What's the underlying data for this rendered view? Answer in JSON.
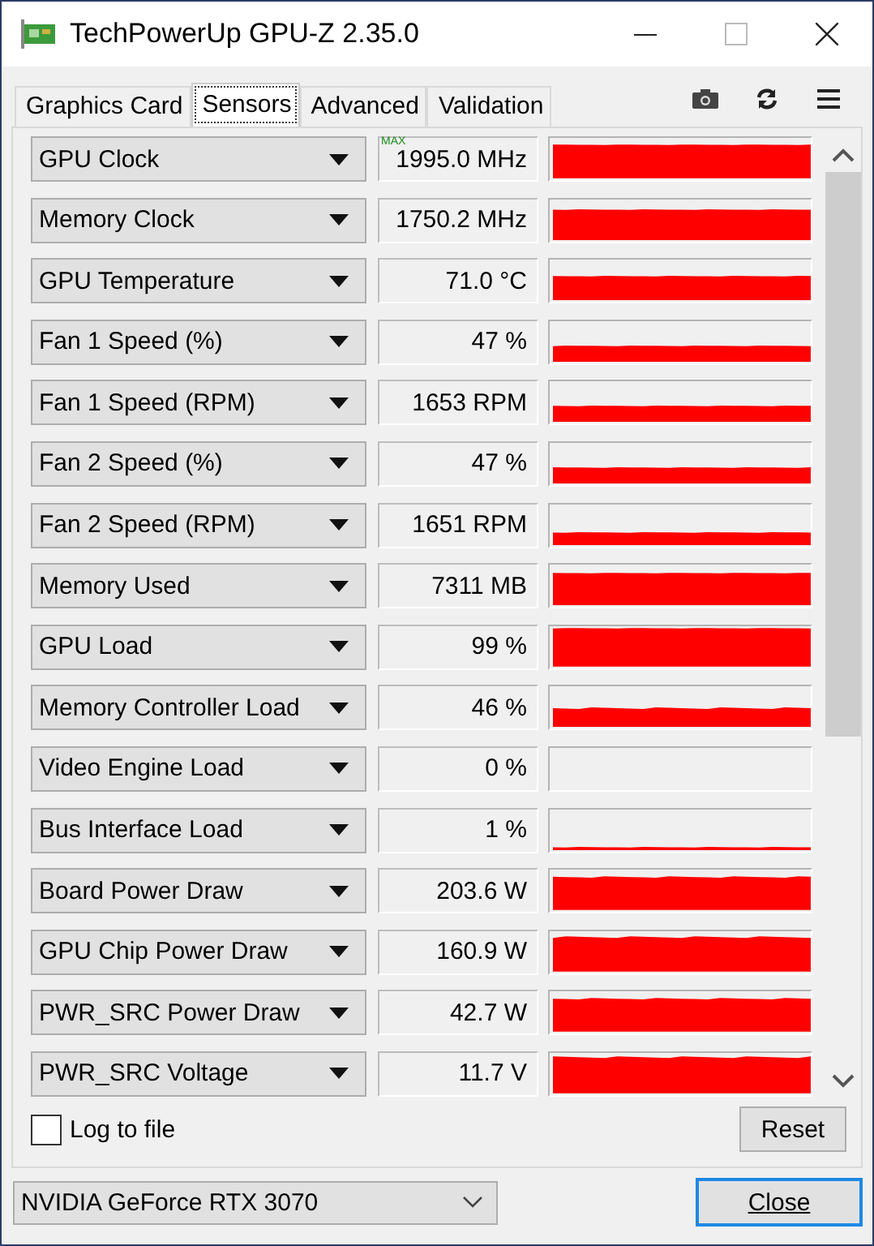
{
  "window": {
    "title": "TechPowerUp GPU-Z 2.35.0"
  },
  "tabs": [
    {
      "label": "Graphics Card",
      "selected": false
    },
    {
      "label": "Sensors",
      "selected": true
    },
    {
      "label": "Advanced",
      "selected": false
    },
    {
      "label": "Validation",
      "selected": false
    }
  ],
  "sensors": [
    {
      "name": "GPU Clock",
      "value": "1995.0 MHz",
      "badge": "MAX"
    },
    {
      "name": "Memory Clock",
      "value": "1750.2 MHz"
    },
    {
      "name": "GPU Temperature",
      "value": "71.0 °C"
    },
    {
      "name": "Fan 1 Speed (%)",
      "value": "47 %"
    },
    {
      "name": "Fan 1 Speed (RPM)",
      "value": "1653 RPM"
    },
    {
      "name": "Fan 2 Speed (%)",
      "value": "47 %"
    },
    {
      "name": "Fan 2 Speed (RPM)",
      "value": "1651 RPM"
    },
    {
      "name": "Memory Used",
      "value": "7311 MB"
    },
    {
      "name": "GPU Load",
      "value": "99 %"
    },
    {
      "name": "Memory Controller Load",
      "value": "46 %"
    },
    {
      "name": "Video Engine Load",
      "value": "0 %"
    },
    {
      "name": "Bus Interface Load",
      "value": "1 %"
    },
    {
      "name": "Board Power Draw",
      "value": "203.6 W"
    },
    {
      "name": "GPU Chip Power Draw",
      "value": "160.9 W"
    },
    {
      "name": "PWR_SRC Power Draw",
      "value": "42.7 W"
    },
    {
      "name": "PWR_SRC Voltage",
      "value": "11.7 V"
    }
  ],
  "log_to_file": {
    "label": "Log to file",
    "checked": false
  },
  "reset_button": "Reset",
  "device": "NVIDIA GeForce RTX 3070",
  "close_button": "Close"
}
